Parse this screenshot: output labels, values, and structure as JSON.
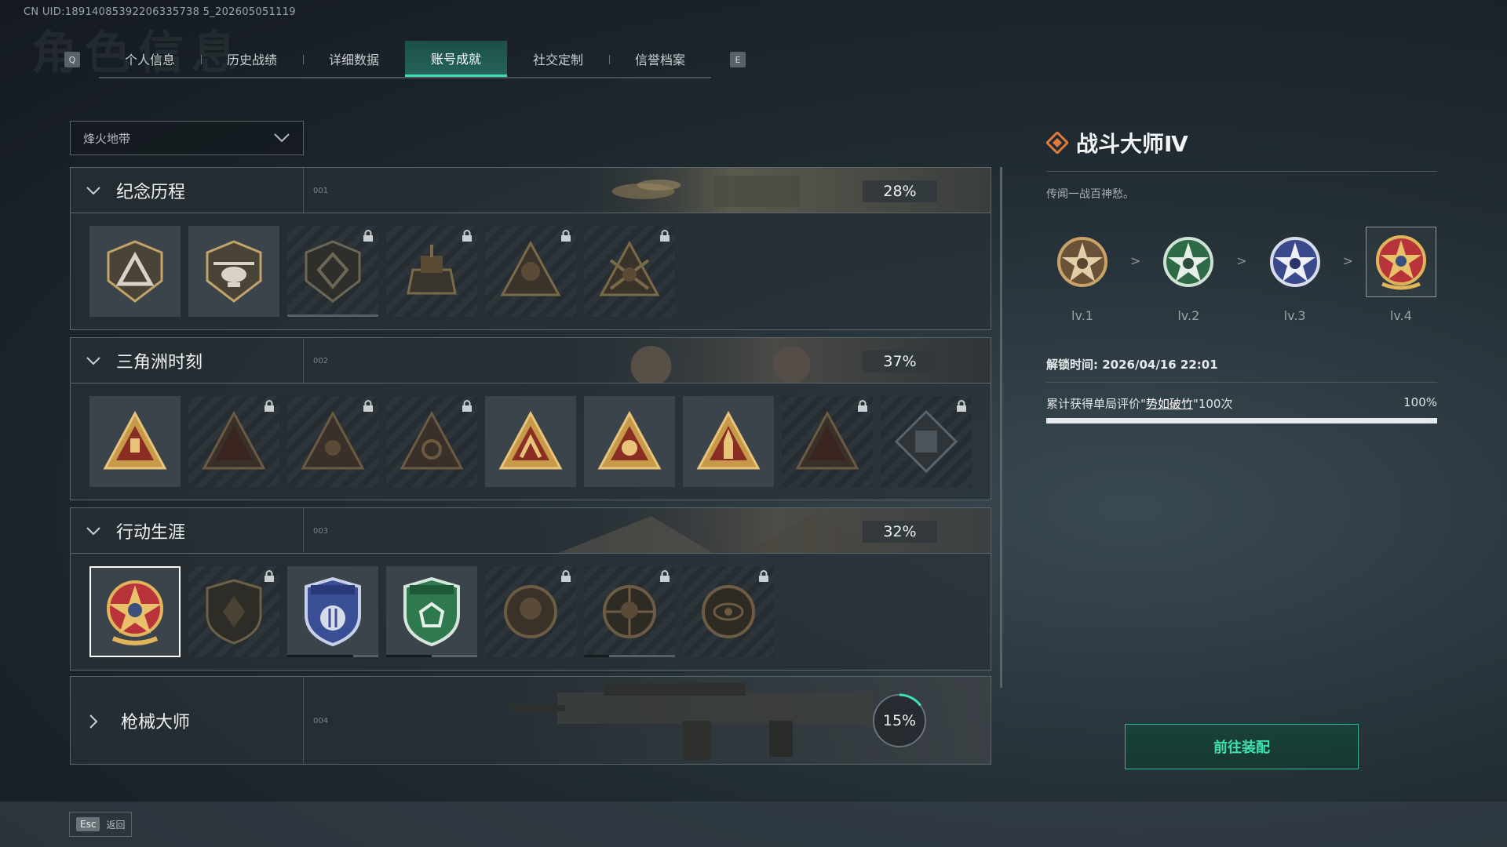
{
  "uid": "CN UID:18914085392206335738 5_202605051119",
  "bg_title": "角色信息",
  "tabs": {
    "left_key": "Q",
    "right_key": "E",
    "items": [
      "个人信息",
      "历史战绩",
      "详细数据",
      "账号成就",
      "社交定制",
      "信誉档案"
    ],
    "active": "账号成就"
  },
  "dropdown": {
    "value": "烽火地带"
  },
  "sections": [
    {
      "title": "纪念历程",
      "num": "001",
      "percent": "28%",
      "badges": 6,
      "locked": [
        false,
        false,
        true,
        true,
        true,
        true
      ]
    },
    {
      "title": "三角洲时刻",
      "num": "002",
      "percent": "37%",
      "badges": 9,
      "locked": [
        false,
        true,
        true,
        true,
        false,
        false,
        false,
        true,
        true
      ]
    },
    {
      "title": "行动生涯",
      "num": "003",
      "percent": "32%",
      "badges": 7,
      "locked": [
        false,
        true,
        false,
        false,
        true,
        true,
        true
      ]
    },
    {
      "title": "枪械大师",
      "num": "004",
      "percent": "15%",
      "progress": 0.15
    }
  ],
  "detail": {
    "title": "战斗大师Ⅳ",
    "description": "传闻一战百神愁。",
    "levels": [
      "lv.1",
      "lv.2",
      "lv.3",
      "lv.4"
    ],
    "level_separator": ">",
    "unlock_time": "解锁时间: 2026/04/16 22:01",
    "requirement_prefix": "累计获得单局评价\"",
    "requirement_link": "势如破竹",
    "requirement_suffix": "\"100次",
    "requirement_percent": "100%",
    "requirement_progress": 1.0
  },
  "equip_button": "前往装配",
  "footer": {
    "esc_key": "Esc",
    "back_label": "返回"
  },
  "colors": {
    "accent": "#3fe0b8",
    "gold": "#c9a25a",
    "title_icon": "#e07a3a"
  }
}
